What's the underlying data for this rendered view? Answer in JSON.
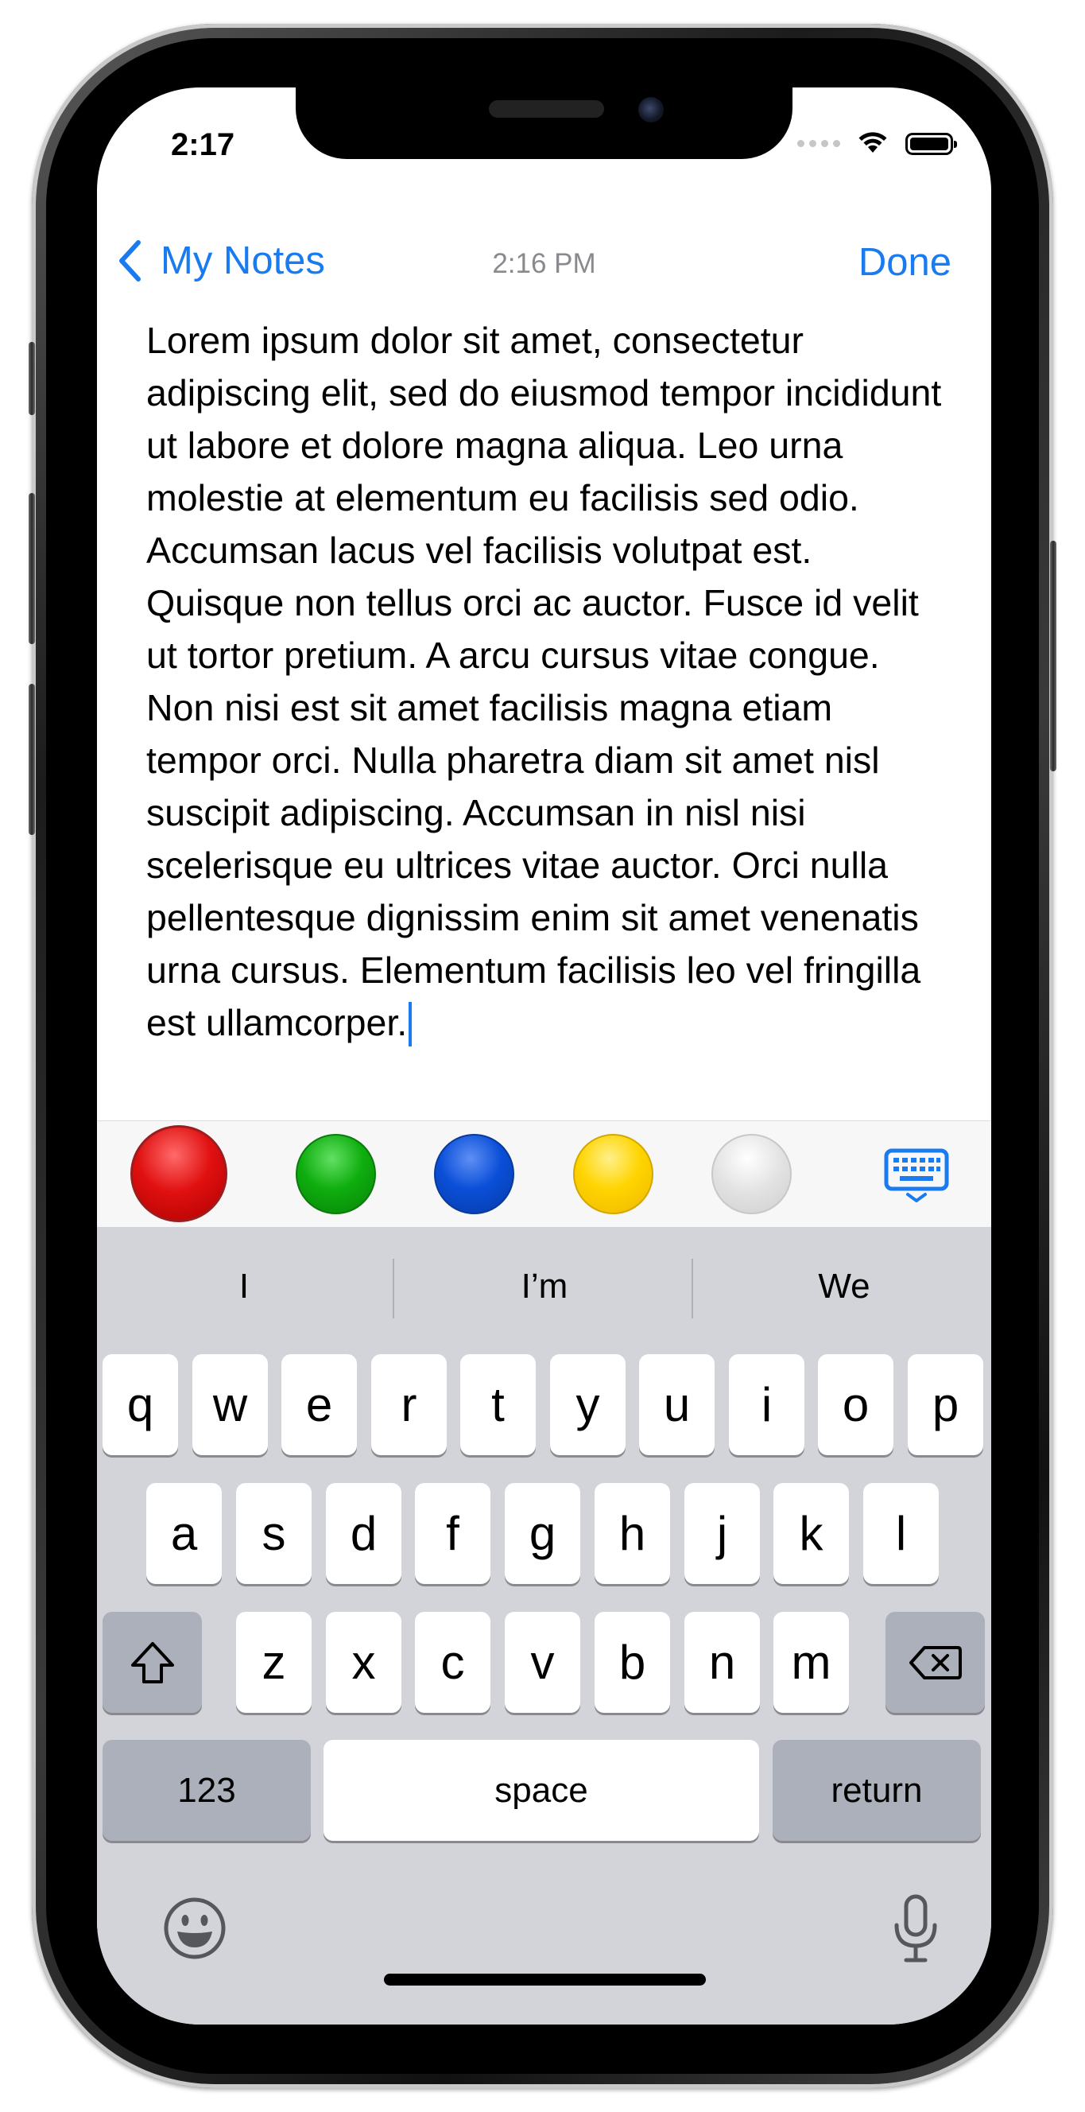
{
  "status_bar": {
    "time": "2:17"
  },
  "nav": {
    "back_label": "My Notes",
    "time": "2:16 PM",
    "done_label": "Done"
  },
  "note": {
    "text": "Lorem ipsum dolor sit amet, consectetur adipiscing elit, sed do eiusmod tempor incididunt ut labore et dolore magna aliqua. Leo urna molestie at elementum eu facilisis sed odio. Accumsan lacus vel facilisis volutpat est. Quisque non tellus orci ac auctor. Fusce id velit ut tortor pretium. A arcu cursus vitae congue. Non nisi est sit amet facilisis magna etiam tempor orci. Nulla pharetra diam sit amet nisl suscipit adipiscing. Accumsan in nisl nisi scelerisque eu ultrices vitae auctor. Orci nulla pellentesque dignissim enim sit amet venenatis urna cursus. Elementum facilisis leo vel fringilla est ullamcorper."
  },
  "color_toolbar": {
    "swatches": [
      {
        "name": "red",
        "color": "#e01010",
        "selected": true
      },
      {
        "name": "green",
        "color": "#0fae0f"
      },
      {
        "name": "blue",
        "color": "#0a4fd8"
      },
      {
        "name": "yellow",
        "color": "#ffd400"
      },
      {
        "name": "gray",
        "color": "#e2e2e2"
      }
    ],
    "keyboard_toggle_icon": "keyboard-dismiss-icon",
    "accent": "#1a7bf0"
  },
  "keyboard": {
    "suggestions": [
      "I",
      "I’m",
      "We"
    ],
    "row1": [
      "q",
      "w",
      "e",
      "r",
      "t",
      "y",
      "u",
      "i",
      "o",
      "p"
    ],
    "row2": [
      "a",
      "s",
      "d",
      "f",
      "g",
      "h",
      "j",
      "k",
      "l"
    ],
    "row3": [
      "z",
      "x",
      "c",
      "v",
      "b",
      "n",
      "m"
    ],
    "shift_icon": "shift-icon",
    "delete_icon": "delete-icon",
    "numbers_label": "123",
    "space_label": "space",
    "return_label": "return",
    "emoji_icon": "emoji-icon",
    "dictation_icon": "microphone-icon"
  }
}
